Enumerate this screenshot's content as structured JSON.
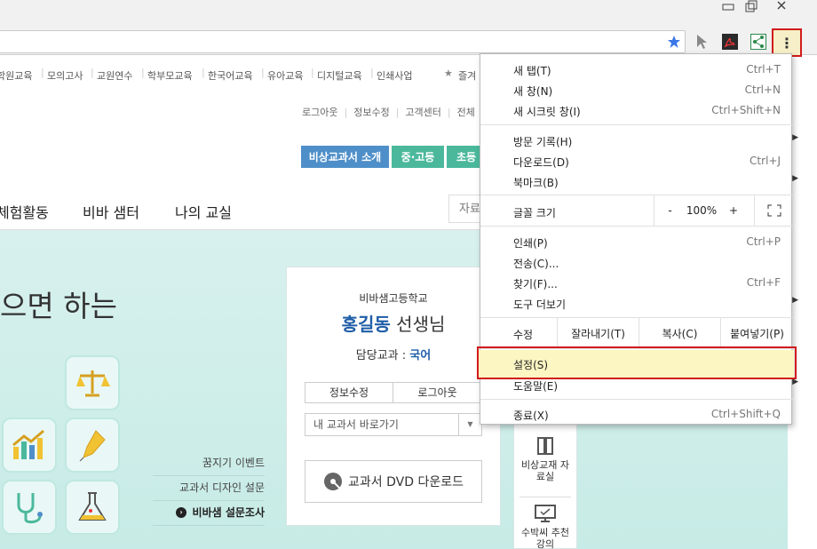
{
  "window": {
    "minimize_icon": "minimize-icon",
    "restore_icon": "restore-icon",
    "close_icon": "close-icon"
  },
  "toolbar": {
    "bookmark_star_icon": "star-icon",
    "extensions": [
      "cursor-icon",
      "pdf-icon",
      "share-icon"
    ],
    "menu_icon": "kebab-icon",
    "menu_glyph": "⋮"
  },
  "topnav": {
    "items": [
      "학원교육",
      "모의고사",
      "교원연수",
      "학부모교육",
      "한국어교육",
      "유아교육",
      "디지털교육",
      "인쇄사업"
    ],
    "favorites": "즐겨"
  },
  "util": {
    "items": [
      "로그아웃",
      "정보수정",
      "고객센터",
      "전체"
    ]
  },
  "tabs": [
    {
      "label": "비상교과서 소개",
      "color": "#4f8fc9"
    },
    {
      "label": "중·고등",
      "color": "#4bb89c"
    },
    {
      "label": "초등",
      "color": "#4bb89c"
    }
  ],
  "mainnav": {
    "items": [
      "체험활동",
      "비바 샘터",
      "나의 교실"
    ],
    "search_label": "자료"
  },
  "hero": {
    "slogan": "으면 하는"
  },
  "sidelinks": [
    "꿈지기 이벤트",
    "교과서 디자인 설문",
    "비바샘 설문조사"
  ],
  "card": {
    "school": "비바샘고등학교",
    "name": "홍길동",
    "title": "선생님",
    "subject_label": "담당교과 : ",
    "subject": "국어",
    "edit_btn": "정보수정",
    "logout_btn": "로그아웃",
    "select": "내 교과서 바로가기",
    "dvd_btn": "교과서 DVD 다운로드"
  },
  "rightpanel": {
    "items": [
      "비상교재 자료실",
      "수박씨 추천강의"
    ]
  },
  "menu": {
    "new_tab": {
      "label": "새 탭(T)",
      "shortcut": "Ctrl+T"
    },
    "new_window": {
      "label": "새 창(N)",
      "shortcut": "Ctrl+N"
    },
    "incognito": {
      "label": "새 시크릿 창(I)",
      "shortcut": "Ctrl+Shift+N"
    },
    "history": {
      "label": "방문 기록(H)"
    },
    "downloads": {
      "label": "다운로드(D)",
      "shortcut": "Ctrl+J"
    },
    "bookmarks": {
      "label": "북마크(B)"
    },
    "zoom": {
      "label": "글꼴 크기",
      "minus": "-",
      "value": "100%",
      "plus": "+",
      "fullscreen_icon": "fullscreen-icon"
    },
    "print": {
      "label": "인쇄(P)",
      "shortcut": "Ctrl+P"
    },
    "cast": {
      "label": "전송(C)..."
    },
    "find": {
      "label": "찾기(F)...",
      "shortcut": "Ctrl+F"
    },
    "more_tools": {
      "label": "도구 더보기"
    },
    "edit": {
      "label": "수정",
      "cut": "잘라내기(T)",
      "copy": "복사(C)",
      "paste": "붙여넣기(P)"
    },
    "settings": {
      "label": "설정(S)"
    },
    "help": {
      "label": "도움말(E)"
    },
    "exit": {
      "label": "종료(X)",
      "shortcut": "Ctrl+Shift+Q"
    }
  },
  "colors": {
    "highlight_border": "#d11b1b",
    "highlight_fill": "#fcf6c3",
    "hero_bg": "#c7ebe6",
    "accent_blue": "#1f5ea8"
  }
}
